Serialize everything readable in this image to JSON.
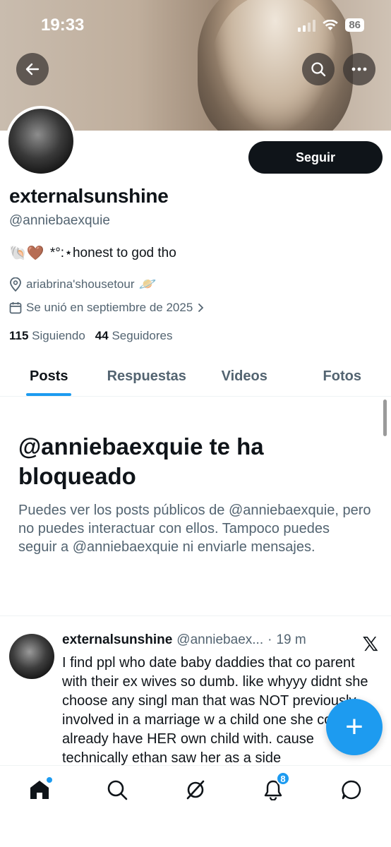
{
  "status_bar": {
    "time": "19:33",
    "battery": "86"
  },
  "header": {
    "back_icon": "arrow-left-icon",
    "search_icon": "search-icon",
    "more_icon": "more-horizontal-icon"
  },
  "profile": {
    "follow_label": "Seguir",
    "display_name": "externalsunshine",
    "handle": "@anniebaexquie",
    "bio_emoji": "🐚🤎",
    "bio_text": "*°:⋆honest to god tho",
    "location": "ariabrina'shousetour",
    "location_emoji": "🪐",
    "joined": "Se unió en septiembre de 2025",
    "following_count": "115",
    "following_label": "Siguiendo",
    "followers_count": "44",
    "followers_label": "Seguidores"
  },
  "tabs": [
    {
      "label": "Posts",
      "active": true
    },
    {
      "label": "Respuestas",
      "active": false
    },
    {
      "label": "Videos",
      "active": false
    },
    {
      "label": "Fotos",
      "active": false
    }
  ],
  "blocked": {
    "title": "@anniebaexquie te ha bloqueado",
    "message": "Puedes ver los posts públicos de @anniebaexquie, pero no puedes interactuar con ellos. Tampoco puedes seguir a @anniebaexquie ni enviarle mensajes."
  },
  "post": {
    "name": "externalsunshine",
    "handle": "@anniebaex...",
    "separator": "·",
    "time": "19 m",
    "text": "I find ppl who date baby daddies that co parent with their ex wives so dumb. like whyyy didnt she choose any singl man that was NOT previously involved in a marriage w a child one she could already have HER own child with.  cause technically ethan saw her as a side"
  },
  "fab_label": "+",
  "bottom_nav": {
    "items": [
      "home-icon",
      "search-icon",
      "grok-icon",
      "notifications-icon",
      "messages-icon"
    ],
    "notifications_badge": "8"
  },
  "colors": {
    "accent": "#1d9bf0",
    "text": "#0f1419",
    "muted": "#536471"
  }
}
